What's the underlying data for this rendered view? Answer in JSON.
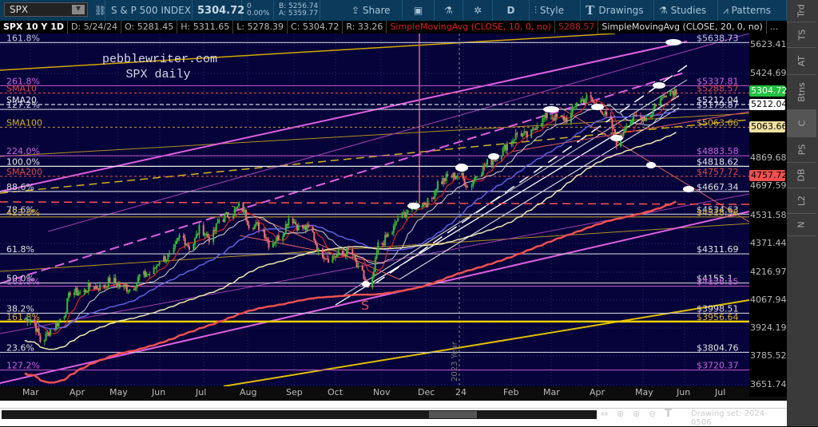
{
  "toolbar": {
    "symbol": "SPX",
    "name": "S & P 500 INDEX",
    "last": "5304.72",
    "change": "0",
    "change_pct": "0.00%",
    "bid": "B: 5256.74",
    "ask": "A: 5359.77",
    "share": "Share",
    "period": "D",
    "style": "Style",
    "drawings": "Drawings",
    "studies": "Studies",
    "patterns": "Patterns"
  },
  "info": {
    "title": "SPX 10 Y 1D",
    "date": "D: 5/24/24",
    "open": "O: 5281.45",
    "high": "H: 5311.65",
    "low": "L: 5278.39",
    "close": "C: 5304.72",
    "range": "R: 33.26",
    "sma10": "SimpleMovingAvg (CLOSE, 10, 0, no)",
    "sma10_val": "5288.57",
    "sma20": "SimpleMovingAvg (CLOSE, 20, 0, no)",
    "more": "..."
  },
  "watermark": {
    "line1": "pebblewriter.com",
    "line2": "SPX daily"
  },
  "year_marker": "2023 Year",
  "s_marker": "S",
  "levels": [
    {
      "left": "161.8%",
      "right": "$5638.73",
      "price": 5638.73,
      "color": "#c8c8d8",
      "lc": "#c8c8d8",
      "dash": ""
    },
    {
      "left": "261.8%",
      "right": "$5337.81",
      "price": 5337.81,
      "color": "#d060e0",
      "lc": "#b050c0",
      "dash": ""
    },
    {
      "left": "SMA10",
      "right": "$5288.57",
      "price": 5288.57,
      "color": "#e04848",
      "lc": "#e04848",
      "dash": "3,3"
    },
    {
      "left": "SMA20",
      "right": "$5212.04",
      "price": 5212.04,
      "color": "#e8e8e8",
      "lc": "#e8e8e8",
      "dash": "5,3"
    },
    {
      "left": "127.2%",
      "right": "$5179.87",
      "price": 5179.87,
      "color": "#c8c8d8",
      "lc": "#c8c8d8",
      "dash": ""
    },
    {
      "left": "SMA100",
      "right": "$5063.66",
      "price": 5063.66,
      "color": "#d4b020",
      "lc": "#b08040",
      "dash": "3,3"
    },
    {
      "left": "224.0%",
      "right": "$4883.58",
      "price": 4883.58,
      "color": "#d060e0",
      "lc": "#b050c0",
      "dash": ""
    },
    {
      "left": "100.0%",
      "right": "$4818.62",
      "price": 4818.62,
      "color": "#e8e8e8",
      "lc": "#e8e8e8",
      "dash": ""
    },
    {
      "left": "SMA200",
      "right": "$4757.72",
      "price": 4757.72,
      "color": "#e04848",
      "lc": "#e04848",
      "dash": "3,3"
    },
    {
      "left": "88.6%",
      "right": "$4667.34",
      "price": 4667.34,
      "color": "#e0e0e0",
      "lc": "#c8c8d8",
      "dash": ""
    },
    {
      "left": "78.6%",
      "right": "$4534.63",
      "price": 4534.63,
      "color": "#e0e0e0",
      "lc": "#c8c8d8",
      "dash": ""
    },
    {
      "left": "423.6%",
      "right": "$4518.58",
      "price": 4518.58,
      "color": "#d4b020",
      "lc": "#b09020",
      "dash": ""
    },
    {
      "left": "61.8%",
      "right": "$4311.69",
      "price": 4311.69,
      "color": "#e0e0e0",
      "lc": "#c8c8d8",
      "dash": ""
    },
    {
      "left": "50.0%",
      "right": "$4155.1",
      "price": 4155.1,
      "color": "#e0e0e0",
      "lc": "#c8c8d8",
      "dash": ""
    },
    {
      "left": "161.8%",
      "right": "$4138.15",
      "price": 4138.15,
      "color": "#d060e0",
      "lc": "#b050c0",
      "dash": ""
    },
    {
      "left": "38.2%",
      "right": "$3998.51",
      "price": 3998.51,
      "color": "#e0e0e0",
      "lc": "#c8c8d8",
      "dash": ""
    },
    {
      "left": "161.8%",
      "right": "$3956.64",
      "price": 3956.64,
      "color": "#d4b020",
      "lc": "#f0d000",
      "dash": ""
    },
    {
      "left": "23.6%",
      "right": "$3804.76",
      "price": 3804.76,
      "color": "#e0e0e0",
      "lc": "#c8c8d8",
      "dash": ""
    },
    {
      "left": "127.2%",
      "right": "$3720.37",
      "price": 3720.37,
      "color": "#d060e0",
      "lc": "#b050c0",
      "dash": ""
    }
  ],
  "price_axis": [
    "5623.41",
    "5424.69",
    "4869.68",
    "4697.59",
    "4531.58",
    "4371.44",
    "4216.97",
    "4067.94",
    "3924.19",
    "3785.52",
    "3651.74"
  ],
  "badges": [
    {
      "value": "5304.72",
      "bg": "#22c040",
      "fg": "#fff"
    },
    {
      "value": "5212.04",
      "bg": "#fff",
      "fg": "#000"
    },
    {
      "value": "5063.66",
      "bg": "#f0e0a0",
      "fg": "#000"
    },
    {
      "value": "4757.72",
      "bg": "#f05050",
      "fg": "#000"
    }
  ],
  "x_axis": [
    "Mar",
    "Apr",
    "May",
    "Jun",
    "Jul",
    "Aug",
    "Sep",
    "Oct",
    "Nov",
    "Dec",
    "24",
    "Feb",
    "Mar",
    "Apr",
    "May",
    "Jun",
    "Jul"
  ],
  "side_tabs": [
    "Trd",
    "TS",
    "AT",
    "Btns",
    "C",
    "PS",
    "DB",
    "L2",
    "N"
  ],
  "drawing_set": "Drawing set: 2024-0506",
  "chart_data": {
    "type": "candlestick",
    "scale": "log",
    "ylim": [
      3600,
      5700
    ],
    "weekly_close_start": "2023-02-24",
    "weekly_close": [
      3970,
      3970,
      3861,
      3917,
      3971,
      4109,
      4105,
      4138,
      4133,
      4169,
      4136,
      4124,
      4192,
      4205,
      4282,
      4299,
      4409,
      4348,
      4450,
      4398,
      4505,
      4536,
      4582,
      4478,
      4464,
      4370,
      4406,
      4515,
      4457,
      4450,
      4320,
      4288,
      4308,
      4327,
      4224,
      4117,
      4358,
      4415,
      4514,
      4559,
      4594,
      4604,
      4719,
      4754,
      4769,
      4697,
      4783,
      4839,
      4891,
      4958,
      5026,
      5005,
      5088,
      5137,
      5123,
      5117,
      5234,
      5254,
      5204,
      5123,
      4967,
      5099,
      5128,
      5127,
      5222,
      5303,
      5304.72
    ]
  }
}
